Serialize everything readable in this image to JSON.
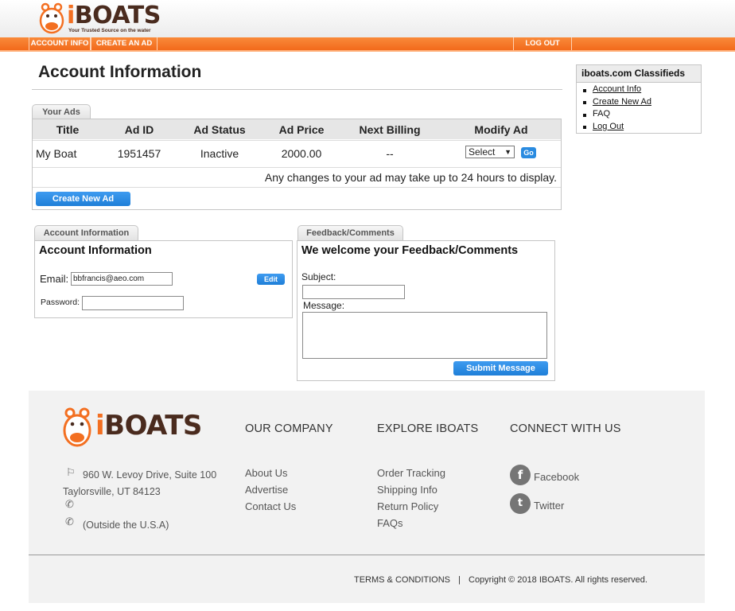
{
  "header": {
    "logo_text_i": "i",
    "logo_text_rest": "BOATS",
    "tagline": "Your Trusted Source on the water",
    "nav": {
      "account_info": "ACCOUNT INFO",
      "create_ad": "CREATE AN AD",
      "log_out": "LOG OUT"
    }
  },
  "page": {
    "title": "Account Information"
  },
  "your_ads": {
    "tab_label": "Your Ads",
    "columns": [
      "Title",
      "Ad ID",
      "Ad Status",
      "Ad Price",
      "Next Billing",
      "Modify Ad"
    ],
    "rows": [
      {
        "title": "My Boat",
        "ad_id": "1951457",
        "status": "Inactive",
        "price": "2000.00",
        "next_billing": "--",
        "modify_select": "Select",
        "go_label": "Go"
      }
    ],
    "notice": "Any changes to your ad may take up to 24 hours to display.",
    "create_button": "Create New Ad"
  },
  "account_panel": {
    "tab_label": "Account Information",
    "heading": "Account Information",
    "email_label": "Email:",
    "email_value": "bbfrancis@aeo.com",
    "edit_button": "Edit",
    "password_label": "Password:",
    "password_value": ""
  },
  "feedback_panel": {
    "tab_label": "Feedback/Comments",
    "heading": "We welcome your Feedback/Comments",
    "subject_label": "Subject:",
    "message_label": "Message:",
    "submit_button": "Submit Message"
  },
  "sidebar": {
    "title": "iboats.com Classifieds",
    "items": [
      {
        "label": "Account Info",
        "link": true
      },
      {
        "label": "Create New Ad",
        "link": true
      },
      {
        "label": "FAQ",
        "link": false
      },
      {
        "label": "Log Out",
        "link": true
      }
    ]
  },
  "footer": {
    "address_line1": "960 W. Levoy Drive, Suite 100",
    "address_line2": "Taylorsville, UT 84123",
    "outside_usa": "(Outside the U.S.A)",
    "col_company": {
      "heading": "OUR COMPANY",
      "links": [
        "About Us",
        "Advertise",
        "Contact Us"
      ]
    },
    "col_explore": {
      "heading": "EXPLORE IBOATS",
      "links": [
        "Order Tracking",
        "Shipping Info",
        "Return Policy",
        "FAQs"
      ]
    },
    "col_connect": {
      "heading": "CONNECT WITH US",
      "links": [
        "Facebook",
        "Twitter"
      ]
    },
    "terms": "TERMS & CONDITIONS",
    "separator": "|",
    "copyright": "Copyright © 2018 IBOATS. All rights reserved."
  },
  "colors": {
    "orange": "#f36f21",
    "brown": "#4a2b1e",
    "blue_button": "#2a8be0",
    "footer_bg": "#f2f2f2"
  },
  "icons": [
    "hippo-mascot-icon",
    "signpost-icon",
    "phone-icon",
    "facebook-icon",
    "twitter-icon",
    "dropdown-arrow-icon"
  ]
}
